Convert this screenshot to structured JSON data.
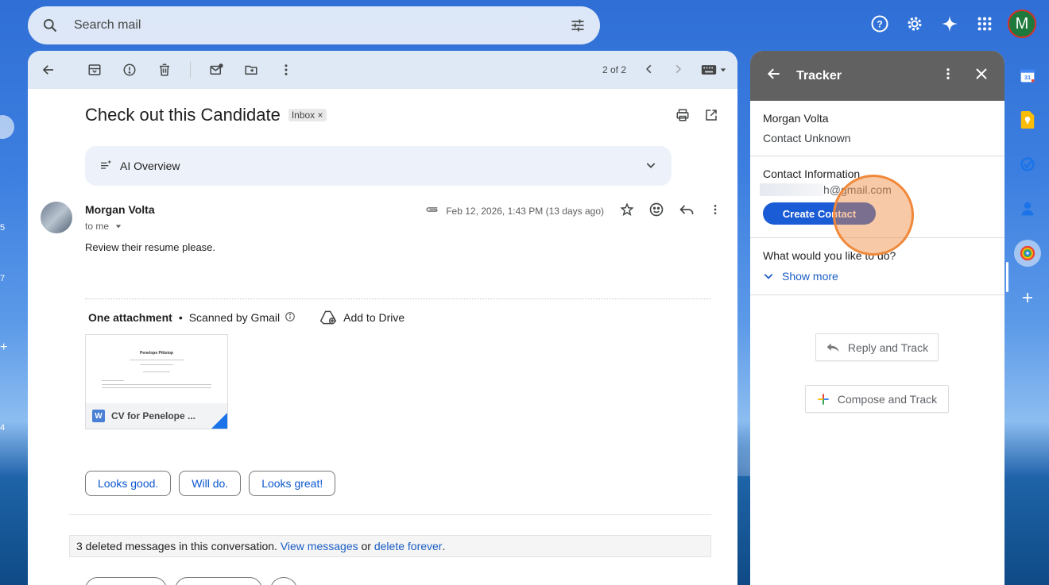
{
  "search": {
    "placeholder": "Search mail"
  },
  "account": {
    "initial": "M"
  },
  "left_rail_numbers": [
    "5",
    "7",
    "+",
    "4"
  ],
  "toolbar": {
    "pager": "2 of 2"
  },
  "message": {
    "subject": "Check out this Candidate",
    "label": "Inbox",
    "label_remove": "×",
    "ai_overview": "AI Overview",
    "sender_name": "Morgan Volta",
    "to": "to me",
    "date": "Feb 12, 2026, 1:43 PM (13 days ago)",
    "body": "Review their resume please."
  },
  "attachment": {
    "heading": "One attachment",
    "bullet": "•",
    "scanned": "Scanned by Gmail",
    "add_to_drive": "Add to Drive",
    "file_icon_letter": "W",
    "file_name": "CV for Penelope ...",
    "doc_name": "Penelope Pittstop"
  },
  "smart_replies": [
    "Looks good.",
    "Will do.",
    "Looks great!"
  ],
  "deleted": {
    "text": "3 deleted messages in this conversation.",
    "view_link": "View messages",
    "or": "or",
    "delete_link": "delete forever",
    "period": "."
  },
  "tracker": {
    "title": "Tracker",
    "contact_name": "Morgan Volta",
    "contact_status": "Contact Unknown",
    "contact_info_label": "Contact Information",
    "email_suffix": "h@gmail.com",
    "create_contact": "Create Contact",
    "question": "What would you like to do?",
    "show_more": "Show more",
    "reply_and_track": "Reply and Track",
    "compose_and_track": "Compose and Track"
  },
  "colors": {
    "accent_blue": "#1a5bd6",
    "tracker_header": "#616161",
    "click_indicator": "#f0883a"
  }
}
